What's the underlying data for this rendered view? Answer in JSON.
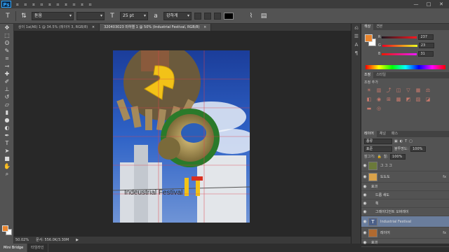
{
  "app": {
    "logo": "Ps",
    "menu": [
      "ㅍ",
      "ㅍ",
      "ㅍ",
      "ㅍ",
      "ㅍ",
      "ㅍ",
      "ㅍ",
      "ㅍ",
      "ㅍ",
      "ㅍ"
    ],
    "win": {
      "min": "—",
      "max": "□",
      "close": "✕"
    }
  },
  "options": {
    "font_family": "돋움",
    "font_size": "25 pt",
    "antialias": "강하게"
  },
  "tabs": [
    {
      "label": "상이 1a(A6) 1 @ 34.5% (레이어 3, RGB/8)",
      "close": "×",
      "active": false
    },
    {
      "label": "320403023 미하엘 1 @ 50% (Industrial Festival, RGB/8)",
      "close": "×",
      "active": true
    }
  ],
  "canvas": {
    "text": "Indeustrial Festival"
  },
  "status": {
    "zoom": "50.02%",
    "doc": "문서: 556.0K/3.30M",
    "play": "▶"
  },
  "bottom_tabs": [
    {
      "label": "Mini Bridge",
      "active": true
    },
    {
      "label": "타임라인",
      "active": false
    }
  ],
  "colors": {
    "foreground": "#e9852e",
    "background": "#ffffff",
    "accent": "#6a7d9c"
  },
  "color_panel": {
    "tabs": [
      "색상",
      "견본"
    ],
    "rows": [
      {
        "label": "R",
        "value": "237"
      },
      {
        "label": "G",
        "value": "23"
      },
      {
        "label": "B",
        "value": "31"
      }
    ]
  },
  "styles_panel": {
    "tabs": [
      "조정",
      "스타일"
    ],
    "heading": "조정 추가"
  },
  "layers_panel": {
    "tabs": [
      "레이어",
      "채널",
      "패스"
    ],
    "kind": "종류",
    "blend": "표준",
    "opacity_label": "불투명도:",
    "opacity": "100%",
    "lock_label": "잠그기:",
    "fill_label": "칠:",
    "fill": "100%",
    "layers": [
      {
        "name": "그 그 그",
        "type": "image",
        "selected": false,
        "fx": ""
      },
      {
        "name": "도도도",
        "type": "image",
        "selected": false,
        "fx": "fx"
      },
      {
        "name": "효과",
        "type": "sub",
        "selected": false,
        "fx": ""
      },
      {
        "name": "드롭 섀도",
        "type": "sub",
        "selected": false,
        "fx": ""
      },
      {
        "name": "획",
        "type": "sub",
        "selected": false,
        "fx": ""
      },
      {
        "name": "그레이디언트 오버레이",
        "type": "sub",
        "selected": false,
        "fx": ""
      },
      {
        "name": "Industrial Festival",
        "type": "text",
        "selected": true,
        "fx": ""
      },
      {
        "name": "레이어",
        "type": "image",
        "selected": false,
        "fx": "fx"
      },
      {
        "name": "효과",
        "type": "sub",
        "selected": false,
        "fx": ""
      }
    ]
  },
  "icons": {
    "tools": [
      "move-icon",
      "marquee-icon",
      "lasso-icon",
      "quick-select-icon",
      "crop-icon",
      "eyedropper-icon",
      "healing-icon",
      "brush-icon",
      "clone-stamp-icon",
      "history-brush-icon",
      "eraser-icon",
      "gradient-icon",
      "blur-icon",
      "dodge-icon",
      "pen-icon",
      "type-icon",
      "path-select-icon",
      "shape-icon",
      "hand-icon",
      "zoom-icon"
    ]
  }
}
